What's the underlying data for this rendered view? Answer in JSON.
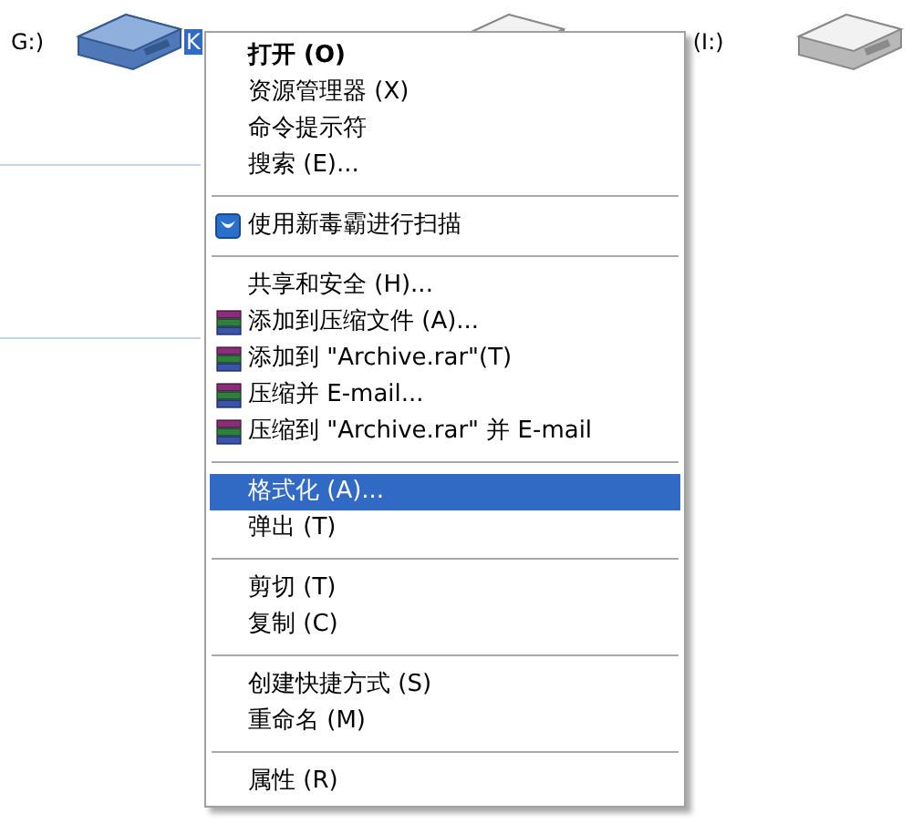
{
  "tiles": [
    {
      "label": "G:)",
      "selected": false
    },
    {
      "label": "K",
      "selected": true
    },
    {
      "label": "(I:)",
      "selected": false
    },
    {
      "selected": false
    }
  ],
  "context_menu": [
    {
      "kind": "item",
      "label": "打开 (O)",
      "default": true,
      "selected": false
    },
    {
      "kind": "item",
      "label": "资源管理器 (X)",
      "default": false,
      "selected": false
    },
    {
      "kind": "item",
      "label": "命令提示符",
      "default": false,
      "selected": false
    },
    {
      "kind": "item",
      "label": "搜索 (E)...",
      "default": false,
      "selected": false
    },
    {
      "kind": "separator"
    },
    {
      "kind": "scan_item",
      "label": "使用新毒霸进行扫描",
      "default": false,
      "selected": false
    },
    {
      "kind": "separator"
    },
    {
      "kind": "item",
      "label": "共享和安全 (H)...",
      "default": false,
      "selected": false
    },
    {
      "kind": "archive_item",
      "label": "添加到压缩文件 (A)...",
      "default": false,
      "selected": false
    },
    {
      "kind": "archive_item",
      "label": "添加到 \"Archive.rar\"(T)",
      "default": false,
      "selected": false
    },
    {
      "kind": "archive_item",
      "label": "压缩并 E-mail...",
      "default": false,
      "selected": false
    },
    {
      "kind": "archive_item",
      "label": "压缩到 \"Archive.rar\" 并 E-mail",
      "default": false,
      "selected": false
    },
    {
      "kind": "separator"
    },
    {
      "kind": "item",
      "label": "格式化 (A)...",
      "default": false,
      "selected": true
    },
    {
      "kind": "item",
      "label": "弹出 (T)",
      "default": false,
      "selected": false
    },
    {
      "kind": "separator"
    },
    {
      "kind": "item",
      "label": "剪切 (T)",
      "default": false,
      "selected": false
    },
    {
      "kind": "item",
      "label": "复制 (C)",
      "default": false,
      "selected": false
    },
    {
      "kind": "separator"
    },
    {
      "kind": "item",
      "label": "创建快捷方式 (S)",
      "default": false,
      "selected": false
    },
    {
      "kind": "item",
      "label": "重命名 (M)",
      "default": false,
      "selected": false
    },
    {
      "kind": "separator"
    },
    {
      "kind": "item",
      "label": "属性 (R)",
      "default": false,
      "selected": false
    }
  ]
}
